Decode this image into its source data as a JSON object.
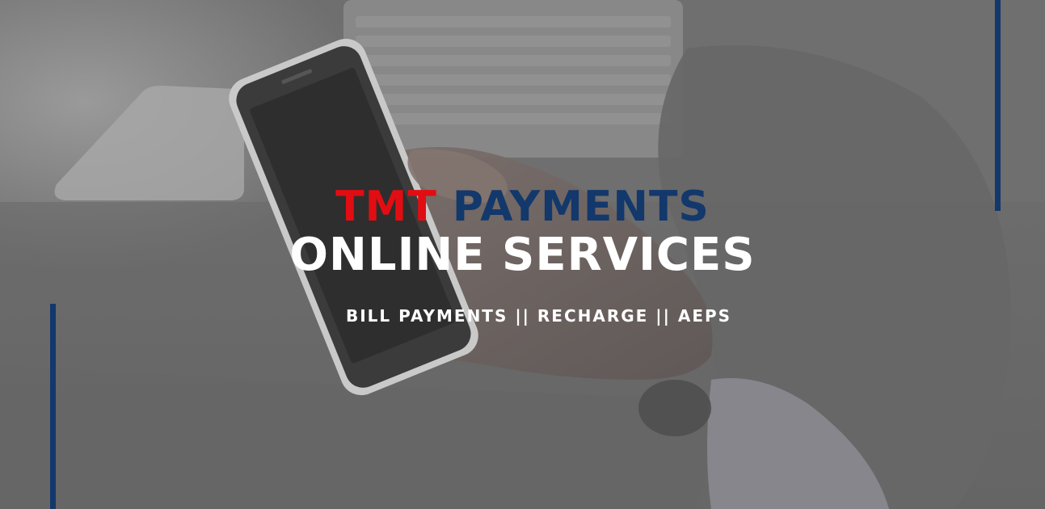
{
  "banner": {
    "brand_first": "TMT",
    "brand_second": "PAYMENTS",
    "title": "ONLINE SERVICES",
    "tagline": "BILL PAYMENTS || RECHARGE || AEPS"
  },
  "colors": {
    "brand_red": "#e20d12",
    "brand_blue": "#13386c",
    "overlay_gray": "#6f6f6f",
    "text_white": "#ffffff"
  },
  "background": {
    "subject": "hand-holding-smartphone-photo"
  }
}
